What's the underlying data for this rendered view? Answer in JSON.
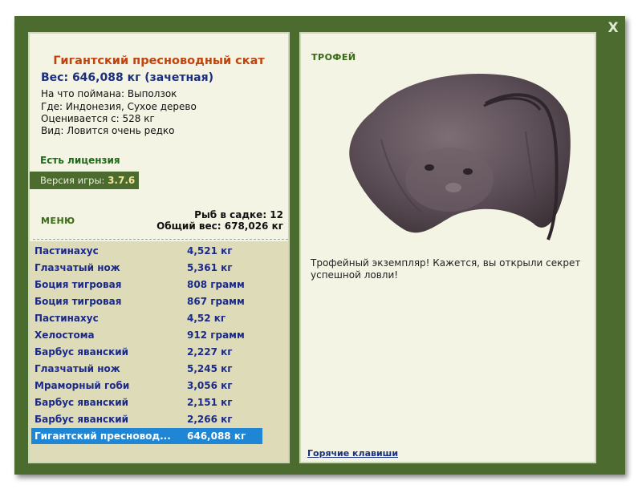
{
  "close_label": "X",
  "fish": {
    "title": "Гигантский пресноводный скат",
    "weight": "Вес: 646,088 кг (зачетная)",
    "bait": "На что поймана: Выползок",
    "location": "Где: Индонезия, Сухое дерево",
    "value": "Оценивается с: 528 кг",
    "rarity": "Вид: Ловится очень редко"
  },
  "license": "Есть лицензия",
  "version": {
    "label": "Версия игры:",
    "number": "3.7.6"
  },
  "menu_label": "МЕНЮ",
  "keepnet": {
    "count": "Рыб в садке: 12",
    "total": "Общий вес: 678,026 кг"
  },
  "catch_list": [
    {
      "name": "Пастинахус",
      "weight": "4,521 кг"
    },
    {
      "name": "Глазчатый нож",
      "weight": "5,361 кг"
    },
    {
      "name": "Боция тигровая",
      "weight": "808 грамм"
    },
    {
      "name": "Боция тигровая",
      "weight": "867 грамм"
    },
    {
      "name": "Пастинахус",
      "weight": "4,52 кг"
    },
    {
      "name": "Хелостома",
      "weight": "912 грамм"
    },
    {
      "name": "Барбус яванский",
      "weight": "2,227 кг"
    },
    {
      "name": "Глазчатый нож",
      "weight": "5,245 кг"
    },
    {
      "name": "Мраморный гоби",
      "weight": "3,056 кг"
    },
    {
      "name": "Барбус яванский",
      "weight": "2,151 кг"
    },
    {
      "name": "Барбус яванский",
      "weight": "2,266 кг"
    },
    {
      "name": "Гигантский пресновод...",
      "weight": "646,088 кг"
    }
  ],
  "trophy_label": "ТРОФЕЙ",
  "trophy_text": "Трофейный экземпляр! Кажется, вы открыли секрет успешной ловли!",
  "hotkeys": "Горячие клавиши",
  "colors": {
    "frame": "#4b6c2e",
    "panel": "#f4f4e4",
    "list_bg": "#dedcb8",
    "title": "#c0440f",
    "selected": "#1f86d6",
    "name_blue": "#1b2a8a"
  }
}
